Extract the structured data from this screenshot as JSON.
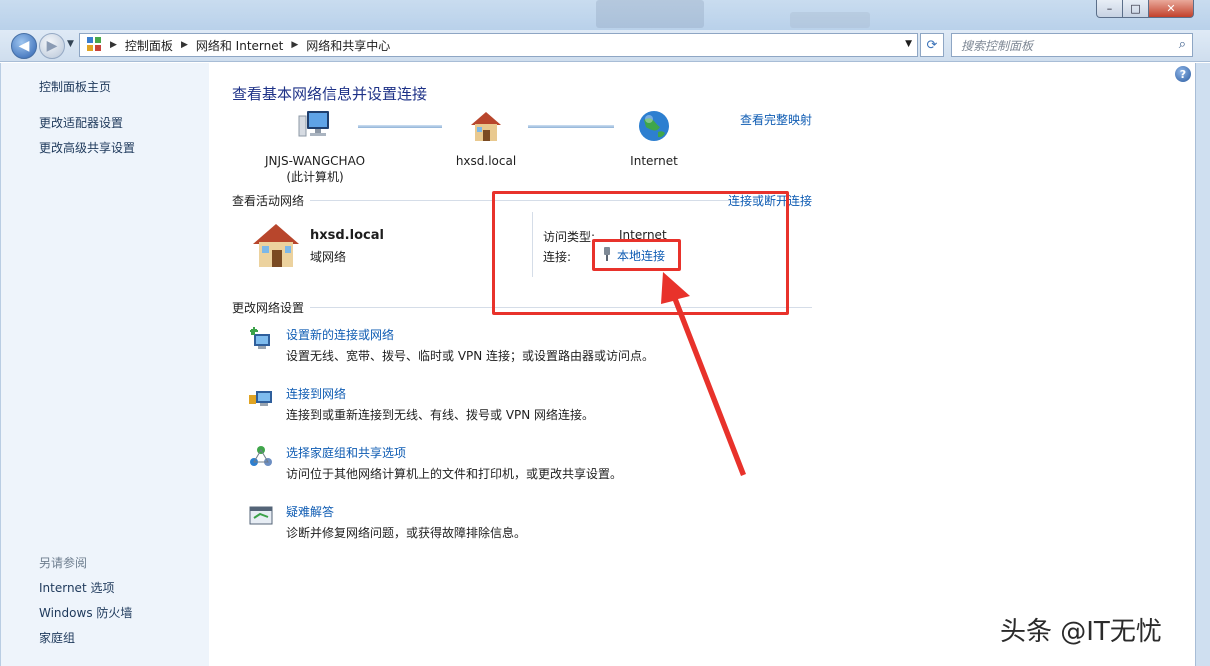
{
  "window": {
    "controls": {
      "minimize": "–",
      "maximize": "□",
      "close": "✕"
    }
  },
  "addressbar": {
    "breadcrumbs": [
      "控制面板",
      "网络和 Internet",
      "网络和共享中心"
    ],
    "search_placeholder": "搜索控制面板"
  },
  "sidebar": {
    "links": [
      "控制面板主页",
      "更改适配器设置",
      "更改高级共享设置"
    ],
    "see_also_label": "另请参阅",
    "see_also": [
      "Internet 选项",
      "Windows 防火墙",
      "家庭组"
    ]
  },
  "main": {
    "title": "查看基本网络信息并设置连接",
    "view_full_map": "查看完整映射",
    "nodes": [
      {
        "name": "JNJS-WANGCHAO",
        "sub": "(此计算机)",
        "icon": "computer-icon"
      },
      {
        "name": "hxsd.local",
        "sub": "",
        "icon": "house-icon"
      },
      {
        "name": "Internet",
        "sub": "",
        "icon": "globe-icon"
      }
    ],
    "active_networks_label": "查看活动网络",
    "connect_disconnect": "连接或断开连接",
    "network": {
      "name": "hxsd.local",
      "type": "域网络",
      "access_type_label": "访问类型:",
      "access_type_value": "Internet",
      "connection_label": "连接:",
      "connection_value": "本地连接"
    },
    "change_settings_label": "更改网络设置",
    "tasks": [
      {
        "link": "设置新的连接或网络",
        "desc": "设置无线、宽带、拨号、临时或 VPN 连接；或设置路由器或访问点。",
        "icon": "new-connection-icon"
      },
      {
        "link": "连接到网络",
        "desc": "连接到或重新连接到无线、有线、拨号或 VPN 网络连接。",
        "icon": "connect-network-icon"
      },
      {
        "link": "选择家庭组和共享选项",
        "desc": "访问位于其他网络计算机上的文件和打印机，或更改共享设置。",
        "icon": "homegroup-icon"
      },
      {
        "link": "疑难解答",
        "desc": "诊断并修复网络问题，或获得故障排除信息。",
        "icon": "troubleshoot-icon"
      }
    ]
  },
  "watermark": "头条 @IT无忧",
  "colors": {
    "annotation": "#e8322b",
    "link": "#0f5cb3",
    "title": "#1e3287"
  }
}
